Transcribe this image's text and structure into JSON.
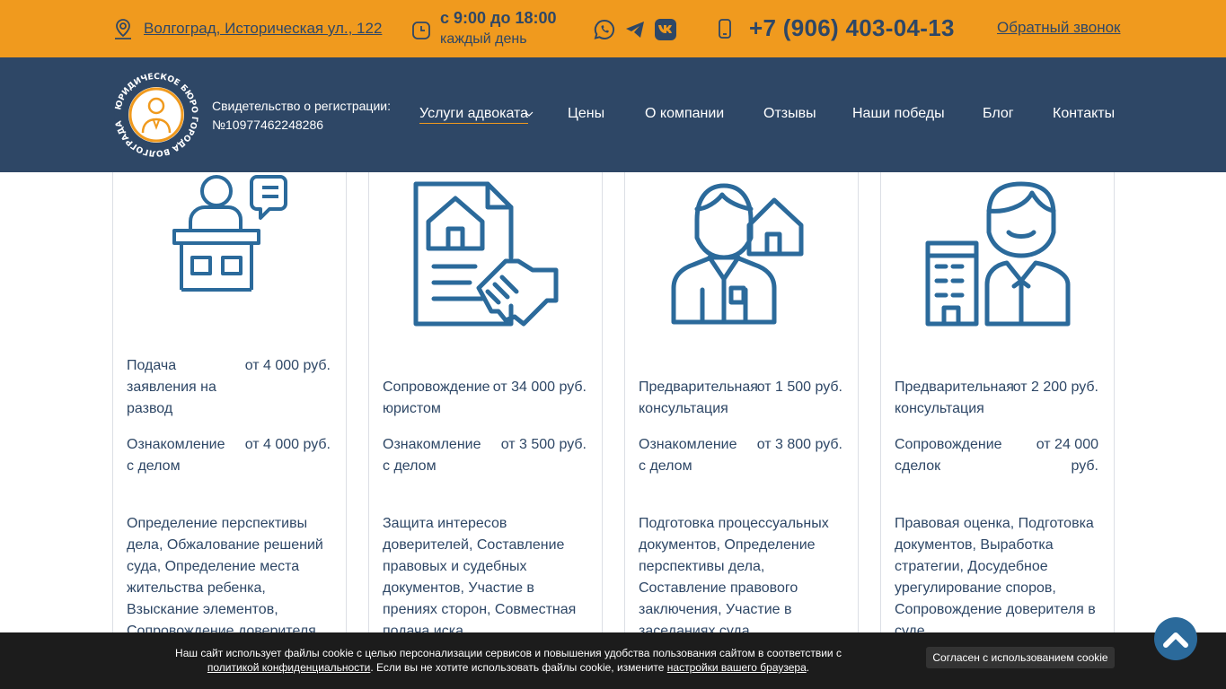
{
  "topbar": {
    "address": "Волгоград, Историческая ул., 122",
    "hours_line1": "с 9:00 до 18:00",
    "hours_line2": "каждый день",
    "socials": [
      "whatsapp-icon",
      "telegram-icon",
      "vk-icon"
    ],
    "phone": "+7 (906) 403-04-13",
    "callback": "Обратный звонок",
    "bg_color": "#f09a1e"
  },
  "header": {
    "logo_text": "ЮРИДИЧЕСКОЕ БЮРО ГОРОДА ВОЛГОГРАДА",
    "reg_line1": "Свидетельство о регистрации:",
    "reg_line2": "№10977462248286",
    "bg_color": "#2e4766",
    "nav": [
      {
        "label": "Услуги адвоката"
      },
      {
        "label": "Цены"
      },
      {
        "label": "О компании"
      },
      {
        "label": "Отзывы"
      },
      {
        "label": "Наши победы"
      },
      {
        "label": "Блог"
      },
      {
        "label": "Контакты"
      }
    ]
  },
  "cards": [
    {
      "icon": "lawyer-at-desk-icon",
      "services": [
        {
          "name": "Подача заявления на развод",
          "price": "от 4 000 руб."
        },
        {
          "name": "Ознакомление с делом",
          "price": "от 4 000 руб."
        }
      ],
      "description": "Определение перспективы дела, Обжалование решений суда, Определение места жительства ребенка, Взыскание элементов, Сопровождение доверителя"
    },
    {
      "icon": "property-contract-handshake-icon",
      "services": [
        {
          "name": "Сопровождение юристом",
          "price": "от 34 000 руб."
        },
        {
          "name": "Ознакомление с делом",
          "price": "от 3 500 руб."
        }
      ],
      "description": "Защита интересов доверителей, Составление правовых и судебных документов, Участие в прениях сторон, Совместная подача иска"
    },
    {
      "icon": "man-with-house-icon",
      "services": [
        {
          "name": "Предварительная консультация",
          "price": "от 1 500 руб."
        },
        {
          "name": "Ознакомление с делом",
          "price": "от 3 800 руб."
        }
      ],
      "description": "Подготовка процессуальных документов, Определение перспективы дела, Составление правового заключения, Участие в заседаниях суда"
    },
    {
      "icon": "businessman-with-building-icon",
      "services": [
        {
          "name": "Предварительная консультация",
          "price": "от 2 200 руб."
        },
        {
          "name": "Сопровождение сделок",
          "price": "от 24 000 руб."
        }
      ],
      "description": "Правовая оценка, Подготовка документов, Выработка стратегии, Досудебное урегулирование споров, Сопровождение доверителя в суде"
    }
  ],
  "cookie": {
    "text_before": "Наш сайт использует файлы cookie с целью персонализации сервисов и повышения удобства пользования сайтом в соответствии с ",
    "link1": "политикой конфиденциальности",
    "text_middle": ". Если вы не хотите использовать файлы cookie, измените ",
    "link2": "настройки вашего браузера",
    "text_after": ".",
    "button": "Согласен с использованием cookie"
  },
  "scroll_top_icon": "chevron-up-icon",
  "accent_color": "#f09a1e",
  "icon_color": "#2b6a9b"
}
